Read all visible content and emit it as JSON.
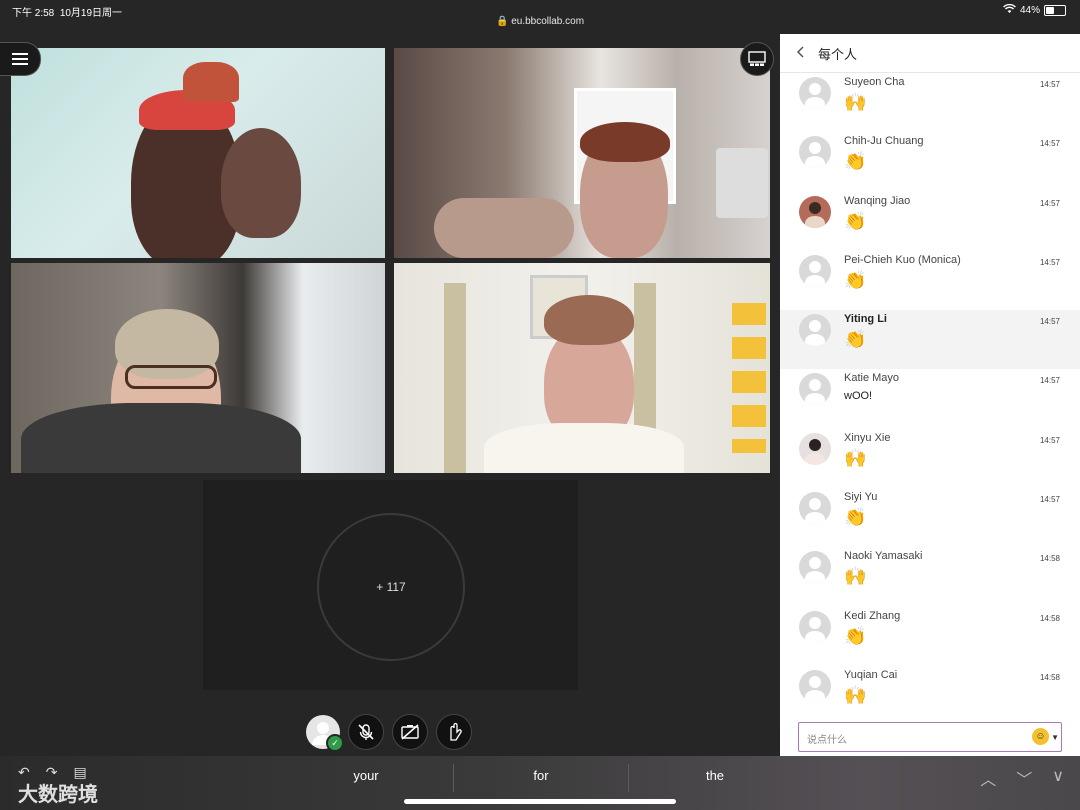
{
  "status_bar": {
    "time": "下午 2:58",
    "date": "10月19日周一",
    "url": "eu.bbcollab.com",
    "battery": "44%",
    "battery_level": 0.44
  },
  "stage": {
    "more_participants": "+ 117"
  },
  "panel": {
    "title": "每个人",
    "messages": [
      {
        "name": "Suyeon Cha",
        "time": "14:57",
        "body": "🙌"
      },
      {
        "name": "Chih-Ju Chuang",
        "time": "14:57",
        "body": "👏"
      },
      {
        "name": "Wanqing Jiao",
        "time": "14:57",
        "body": "👏"
      },
      {
        "name": "Pei-Chieh Kuo (Monica)",
        "time": "14:57",
        "body": "👏"
      },
      {
        "name": "Yiting Li",
        "time": "14:57",
        "body": "👏"
      },
      {
        "name": "Katie Mayo",
        "time": "14:57",
        "body": "wOO!"
      },
      {
        "name": "Xinyu Xie",
        "time": "14:57",
        "body": "🙌"
      },
      {
        "name": "Siyi Yu",
        "time": "14:57",
        "body": "👏"
      },
      {
        "name": "Naoki Yamasaki",
        "time": "14:58",
        "body": "🙌"
      },
      {
        "name": "Kedi Zhang",
        "time": "14:58",
        "body": "👏"
      },
      {
        "name": "Yuqian Cai",
        "time": "14:58",
        "body": "🙌"
      }
    ],
    "composer_placeholder": "说点什么"
  },
  "keyboard": {
    "suggestions": [
      "your",
      "for",
      "the"
    ],
    "watermark": "大数跨境"
  }
}
